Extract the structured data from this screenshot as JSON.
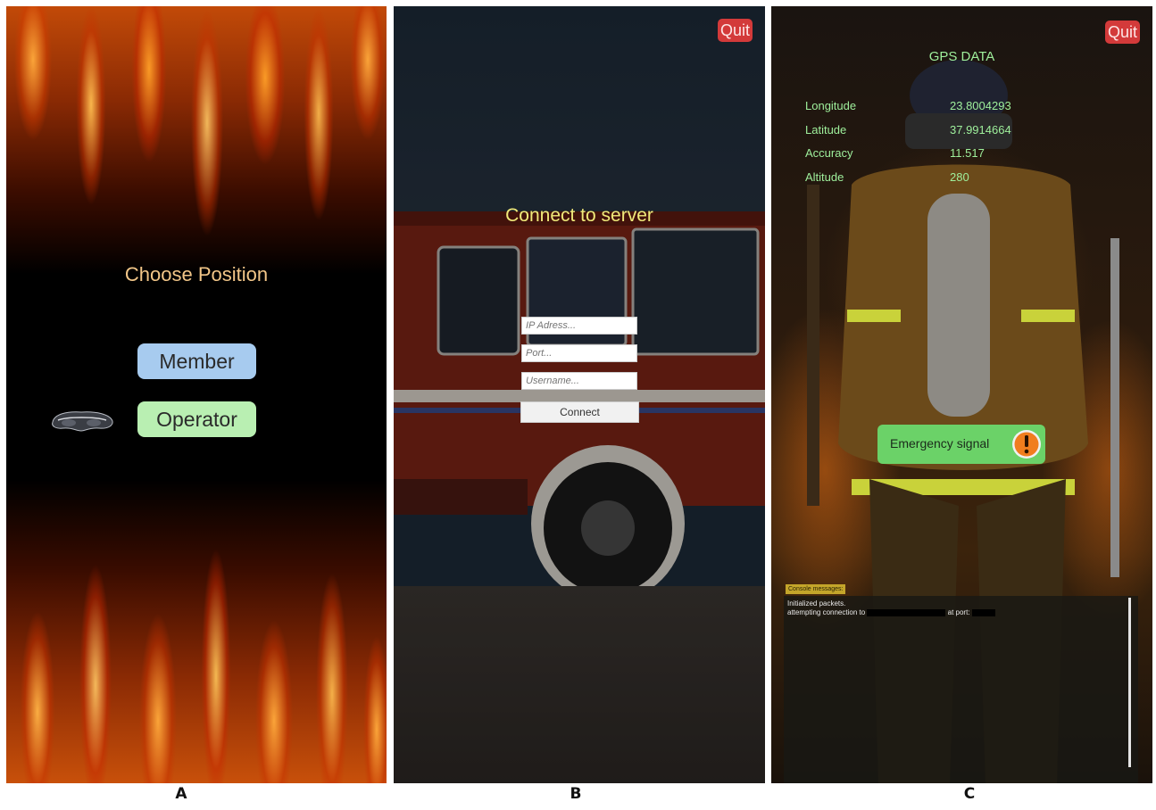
{
  "captions": {
    "a": "A",
    "b": "B",
    "c": "C"
  },
  "panel_a": {
    "title": "Choose Position",
    "member_button": "Member",
    "operator_button": "Operator",
    "icon": "headset-icon"
  },
  "panel_b": {
    "quit_button": "Quit",
    "title": "Connect to server",
    "ip_placeholder": "IP Adress...",
    "port_placeholder": "Port...",
    "username_placeholder": "Username...",
    "connect_button": "Connect"
  },
  "panel_c": {
    "quit_button": "Quit",
    "title": "GPS DATA",
    "gps": [
      {
        "label": "Longitude",
        "value": "23.8004293"
      },
      {
        "label": "Latitude",
        "value": "37.9914664"
      },
      {
        "label": "Accuracy",
        "value": "11.517"
      },
      {
        "label": "Altitude",
        "value": "280"
      }
    ],
    "emergency_button": "Emergency signal",
    "emergency_icon": "alert-icon",
    "console_label": "Console messages:",
    "console_line1": "Initialized packets.",
    "console_line2_prefix": "attempting connection to",
    "console_line2_mid": "at port:"
  },
  "colors": {
    "member_button": "#a7cbef",
    "operator_button": "#b9efb2",
    "quit_button": "#d33a3a",
    "gps_text": "#9ff09c",
    "emergency_button": "#6bd268",
    "server_title": "#f0ea7a",
    "choose_title": "#f2c688"
  }
}
